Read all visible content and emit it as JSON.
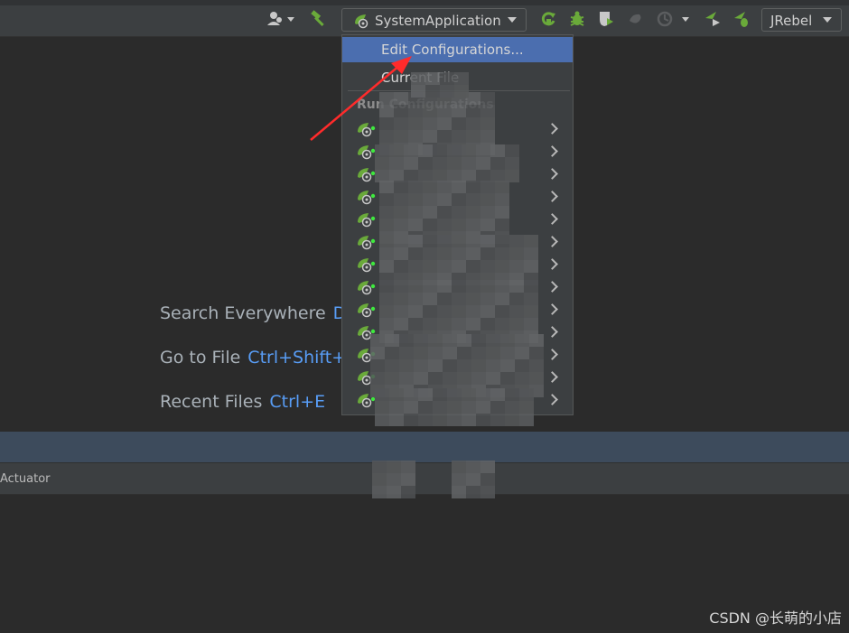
{
  "toolbar": {
    "run_config_label": "SystemApplication",
    "jrebel_label": "JRebel",
    "icons": [
      "user-icon",
      "build-hammer-icon",
      "spring-boot-icon",
      "rerun-icon",
      "debug-bug-icon",
      "coverage-icon",
      "profiler-icon",
      "run-with-icon",
      "jrebel-run-icon",
      "jrebel-debug-icon"
    ]
  },
  "menu": {
    "edit_configurations": "Edit Configurations...",
    "current_file": "Current File",
    "run_configurations_header": "Run Configurations",
    "configs": [
      "",
      "",
      "",
      "",
      "",
      "",
      "",
      "",
      "",
      "",
      "",
      "",
      ""
    ]
  },
  "editor": {
    "hints": [
      {
        "label": "Search Everywhere",
        "key": "Double Shift"
      },
      {
        "label": "Go to File",
        "key": "Ctrl+Shift+N"
      },
      {
        "label": "Recent Files",
        "key": "Ctrl+E"
      }
    ]
  },
  "bottom": {
    "tab_label": "Actuator"
  },
  "watermark": "CSDN @长萌的小店",
  "colors": {
    "selection": "#4b6eaf",
    "shortcut": "#589df6",
    "spring_green": "#6aaa3a",
    "annotation_red": "#ff2b2b"
  }
}
